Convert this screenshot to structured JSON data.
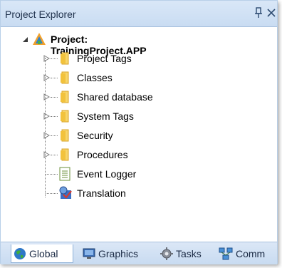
{
  "window": {
    "title": "Project Explorer"
  },
  "tree": {
    "root": {
      "label": "Project: TrainingProject.APP"
    },
    "items": [
      {
        "label": "Project Tags",
        "icon": "folder-icon"
      },
      {
        "label": "Classes",
        "icon": "folder-icon"
      },
      {
        "label": "Shared database",
        "icon": "folder-icon"
      },
      {
        "label": "System Tags",
        "icon": "folder-icon"
      },
      {
        "label": "Security",
        "icon": "folder-icon"
      },
      {
        "label": "Procedures",
        "icon": "folder-icon"
      },
      {
        "label": "Event Logger",
        "icon": "document-list-icon"
      },
      {
        "label": "Translation",
        "icon": "translation-icon"
      }
    ]
  },
  "tabs": [
    {
      "label": "Global",
      "icon": "globe-icon",
      "active": true
    },
    {
      "label": "Graphics",
      "icon": "monitor-icon",
      "active": false
    },
    {
      "label": "Tasks",
      "icon": "gear-icon",
      "active": false
    },
    {
      "label": "Comm",
      "icon": "network-icon",
      "active": false
    }
  ],
  "colors": {
    "titlebar": "#c9dcf2",
    "folder": "#f2c94c",
    "tab_active": "#ffffff"
  }
}
